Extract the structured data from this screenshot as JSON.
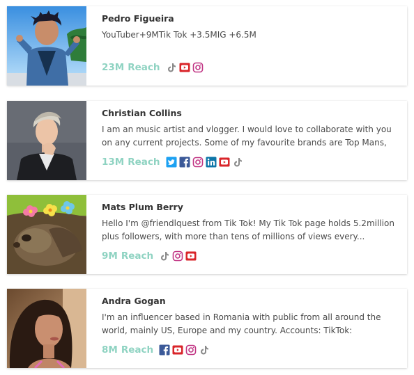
{
  "influencers": [
    {
      "name": "Pedro Figueira",
      "bio": "YouTuber+9MTik Tok +3.5MIG +6.5M",
      "reach_value": "23M",
      "reach_label": "Reach",
      "socials": [
        "tiktok-icon",
        "youtube-icon",
        "instagram-icon"
      ]
    },
    {
      "name": "Christian Collins",
      "bio": "I am an music artist and vlogger. I would love to collaborate with you on any current projects. Some of my favourite brands are Top Mans,",
      "reach_value": "13M",
      "reach_label": "Reach",
      "socials": [
        "twitter-icon",
        "facebook-icon",
        "instagram-icon",
        "linkedin-icon",
        "youtube-icon",
        "tiktok-icon"
      ]
    },
    {
      "name": "Mats Plum Berry",
      "bio": "Hello I'm @friendlquest from Tik Tok! My Tik Tok page holds 5.2million plus followers, with more than tens of millions of views every...",
      "reach_value": "9M",
      "reach_label": "Reach",
      "socials": [
        "tiktok-icon",
        "instagram-icon",
        "youtube-icon"
      ]
    },
    {
      "name": "Andra Gogan",
      "bio": "I'm an influencer based in Romania with public from all around the world, mainly US, Europe and my country. Accounts: TikTok:",
      "reach_value": "8M",
      "reach_label": "Reach",
      "socials": [
        "facebook-icon",
        "youtube-icon",
        "instagram-icon",
        "tiktok-icon"
      ]
    }
  ],
  "colors": {
    "reach": "#8fd3c2",
    "youtube": "#d9252a",
    "instagram": "#c13584",
    "facebook": "#3b5998",
    "twitter": "#1da1f2",
    "linkedin": "#0e76a8",
    "tiktok": "#8a8a8a"
  }
}
